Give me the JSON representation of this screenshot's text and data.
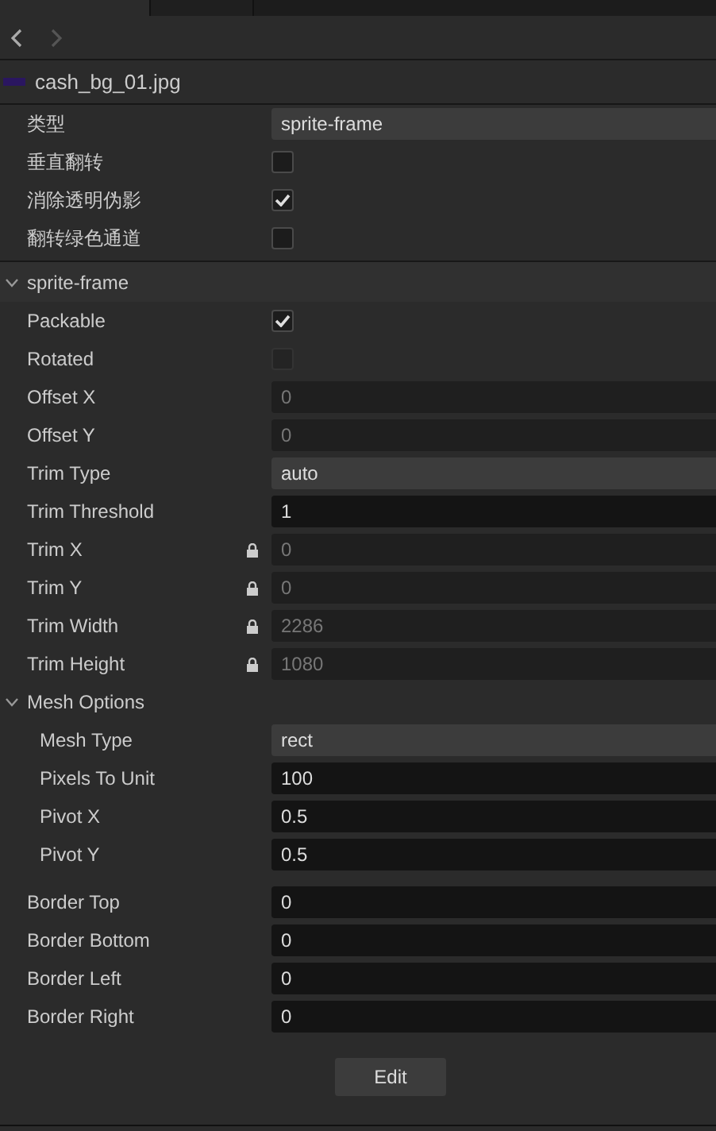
{
  "tabs": [
    {
      "selected": true
    },
    {
      "selected": false
    }
  ],
  "nav": [
    {
      "kind": "back",
      "disabled": false
    },
    {
      "kind": "forward",
      "disabled": true
    }
  ],
  "file": {
    "name": "cash_bg_01.jpg"
  },
  "properties": [
    {
      "label": "类型",
      "kind": "select",
      "value": "sprite-frame"
    },
    {
      "label": "垂直翻转",
      "kind": "checkbox",
      "checked": false
    },
    {
      "label": "消除透明伪影",
      "kind": "checkbox",
      "checked": true
    },
    {
      "label": "翻转绿色通道",
      "kind": "checkbox",
      "checked": false
    }
  ],
  "section": {
    "title": "sprite-frame",
    "expanded": true,
    "properties": [
      {
        "label": "Packable",
        "kind": "checkbox",
        "checked": true
      },
      {
        "label": "Rotated",
        "kind": "checkbox",
        "checked": false,
        "disabled": true
      },
      {
        "label": "Offset X",
        "kind": "number",
        "value": "0",
        "disabled": true
      },
      {
        "label": "Offset Y",
        "kind": "number",
        "value": "0",
        "disabled": true
      },
      {
        "label": "Trim Type",
        "kind": "select",
        "value": "auto"
      },
      {
        "label": "Trim Threshold",
        "kind": "number",
        "value": "1",
        "disabled": false
      },
      {
        "label": "Trim X",
        "kind": "number",
        "value": "0",
        "disabled": true,
        "locked": true
      },
      {
        "label": "Trim Y",
        "kind": "number",
        "value": "0",
        "disabled": true,
        "locked": true
      },
      {
        "label": "Trim Width",
        "kind": "number",
        "value": "2286",
        "disabled": true,
        "locked": true
      },
      {
        "label": "Trim Height",
        "kind": "number",
        "value": "1080",
        "disabled": true,
        "locked": true
      },
      {
        "label": "Mesh Options",
        "kind": "group",
        "expanded": true,
        "children": [
          {
            "label": "Mesh Type",
            "kind": "select",
            "value": "rect"
          },
          {
            "label": "Pixels To Unit",
            "kind": "number",
            "value": "100",
            "disabled": false
          },
          {
            "label": "Pivot X",
            "kind": "number",
            "value": "0.5",
            "disabled": false
          },
          {
            "label": "Pivot Y",
            "kind": "number",
            "value": "0.5",
            "disabled": false
          }
        ]
      },
      {
        "label": "Border Top",
        "kind": "number",
        "value": "0",
        "disabled": false
      },
      {
        "label": "Border Bottom",
        "kind": "number",
        "value": "0",
        "disabled": false
      },
      {
        "label": "Border Left",
        "kind": "number",
        "value": "0",
        "disabled": false
      },
      {
        "label": "Border Right",
        "kind": "number",
        "value": "0",
        "disabled": false
      }
    ]
  },
  "button": {
    "label": "Edit"
  }
}
